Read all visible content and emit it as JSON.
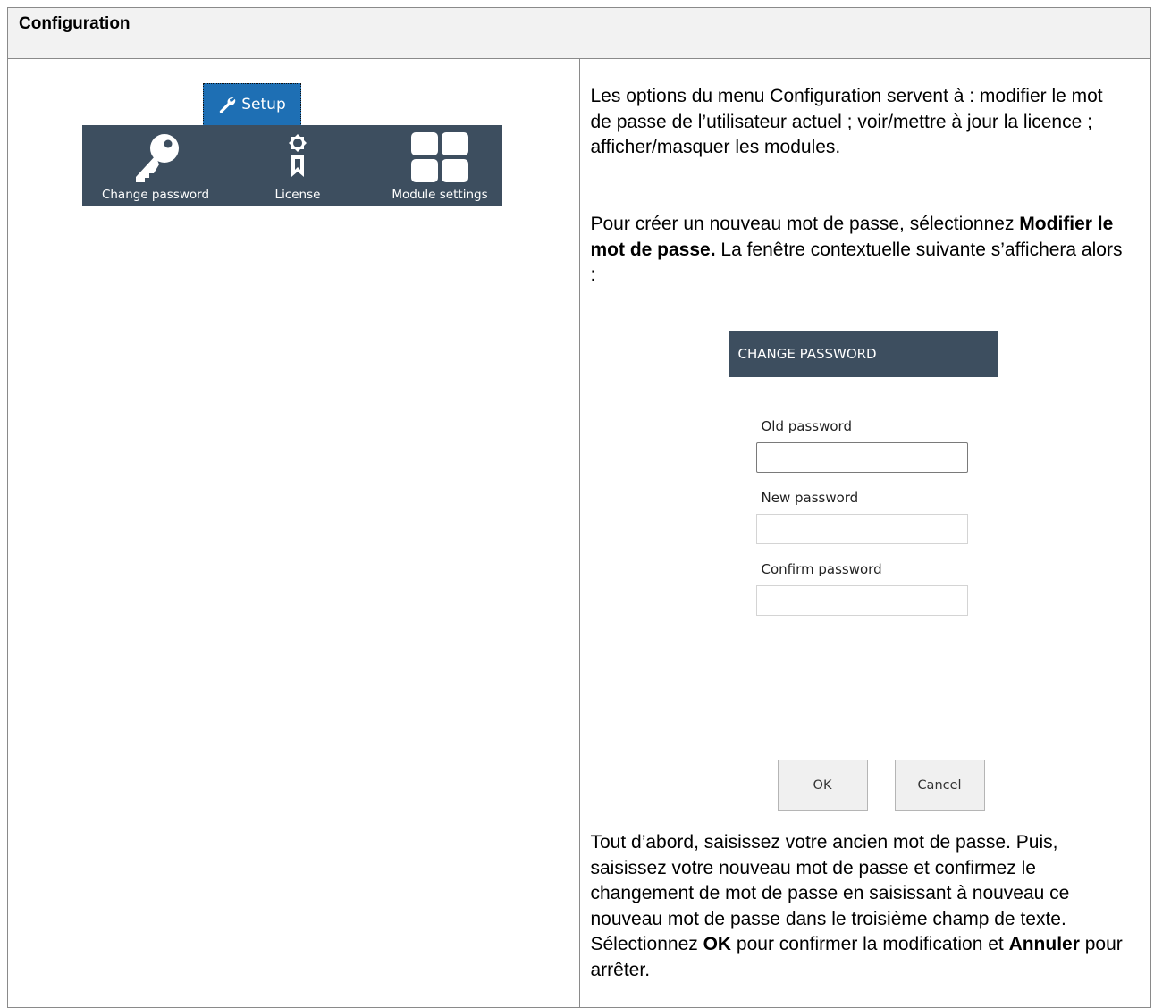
{
  "header": {
    "title": "Configuration"
  },
  "ribbon": {
    "tab_label": "Setup",
    "items": [
      {
        "label": "Change password",
        "icon": "key-icon"
      },
      {
        "label": "License",
        "icon": "license-icon"
      },
      {
        "label": "Module settings",
        "icon": "module-grid-icon"
      }
    ],
    "colors": {
      "tab": "#1e6fb4",
      "bar": "#3d4e5f"
    }
  },
  "text": {
    "p1": "Les options du menu Configuration servent à : modifier le mot de passe de l’utilisateur actuel ; voir/mettre à jour la licence ; afficher/masquer les modules.",
    "p2_a": "Pour créer un nouveau mot de passe, sélectionnez ",
    "p2_bold": "Modifier le mot de passe.",
    "p2_b": " La fenêtre contextuelle suivante s’affichera alors :",
    "p3_a": "Tout d’abord, saisissez votre ancien mot de passe. Puis, saisissez votre nouveau mot de passe et confirmez le changement de mot de passe en saisissant à nouveau ce nouveau mot de passe dans le troisième champ de texte. Sélectionnez ",
    "p3_ok": "OK",
    "p3_b": " pour confirmer la modification et ",
    "p3_cancel": "Annuler",
    "p3_c": " pour arrêter."
  },
  "dialog": {
    "title": "CHANGE PASSWORD",
    "old_label": "Old password",
    "new_label": "New password",
    "confirm_label": "Confirm password",
    "ok": "OK",
    "cancel": "Cancel"
  }
}
